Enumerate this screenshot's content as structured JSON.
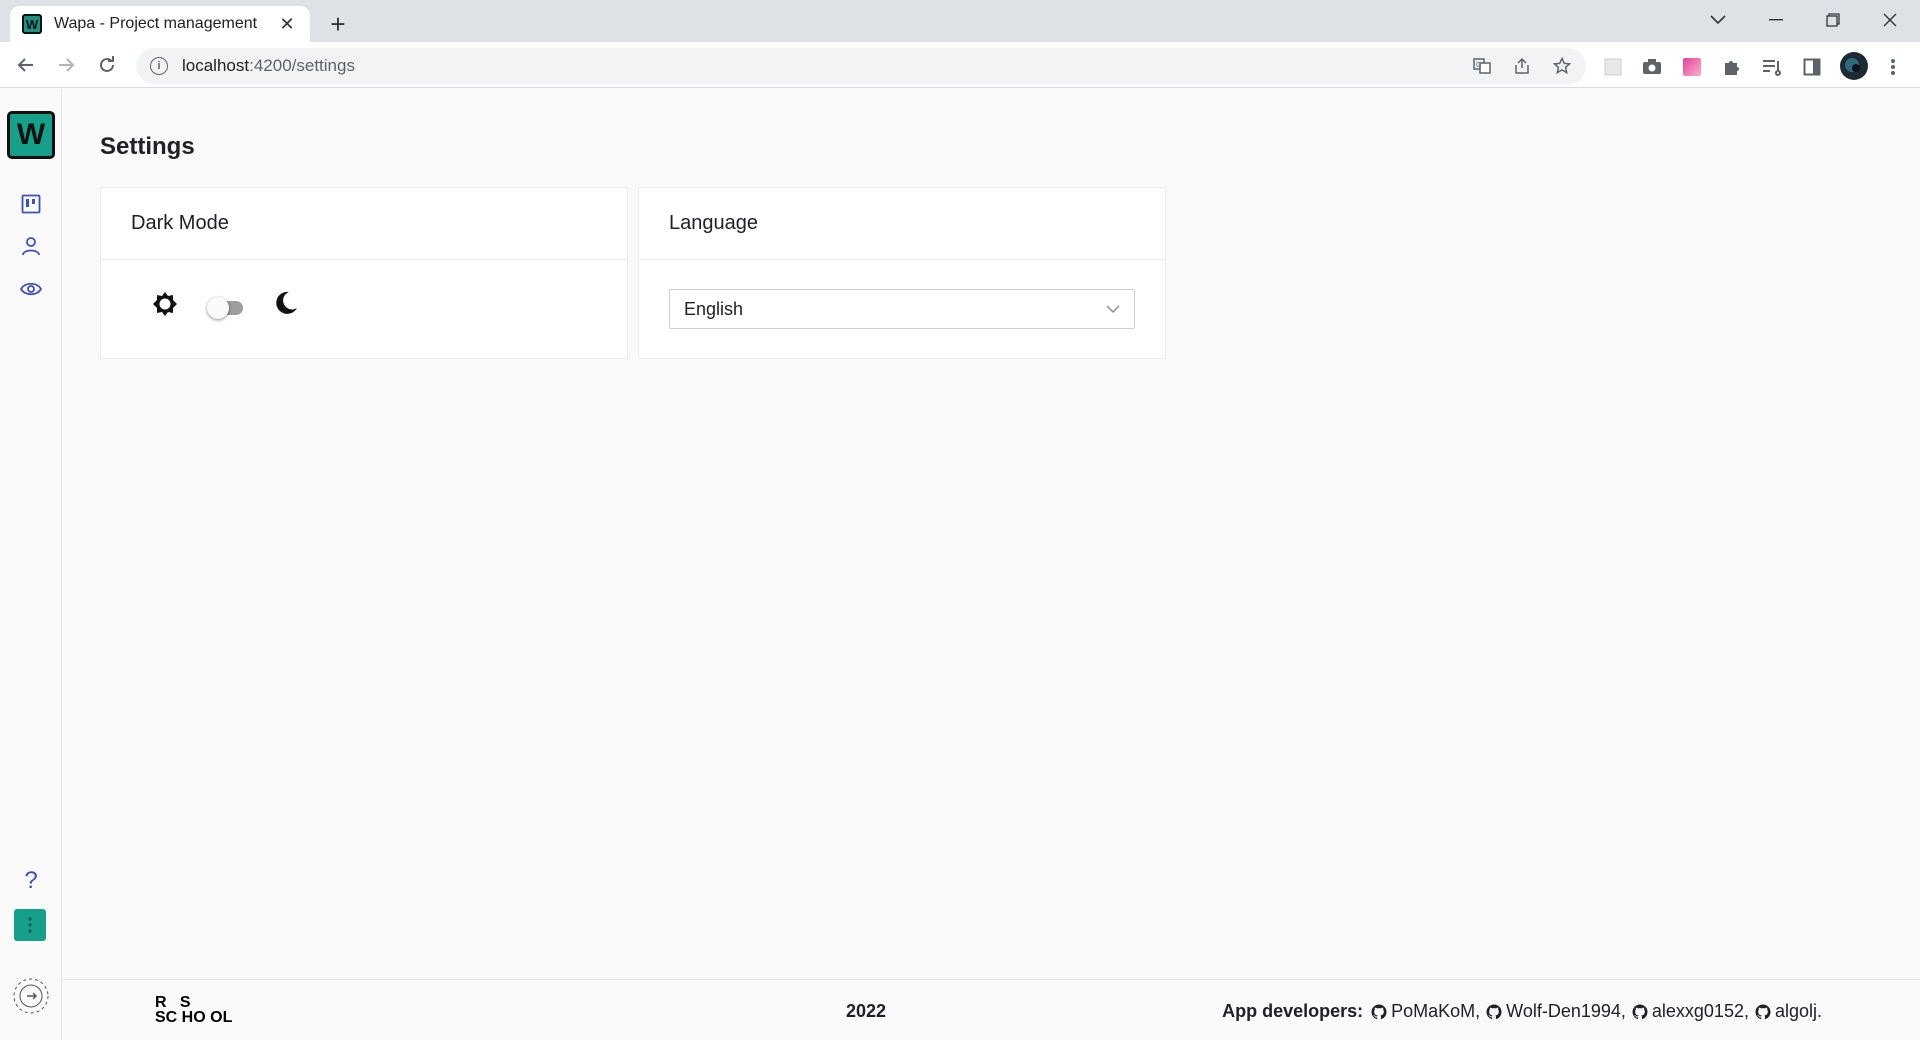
{
  "browser": {
    "tab_title": "Wapa - Project management",
    "tab_favicon_letter": "W",
    "url_host": "localhost",
    "url_path": ":4200/settings",
    "icons": [
      "back-icon",
      "forward-icon",
      "reload-icon",
      "site-info-icon",
      "translate-icon",
      "share-icon",
      "bookmark-star-icon",
      "extension-icon",
      "camera-icon",
      "color-extension-icon",
      "puzzle-icon",
      "reading-list-icon",
      "side-panel-icon",
      "profile-avatar",
      "more-menu-icon"
    ]
  },
  "app": {
    "logo_letter": "W",
    "brand_color": "#16a08a",
    "accent_color": "#3f51b5",
    "sidebar": {
      "items": [
        {
          "icon": "board-icon"
        },
        {
          "icon": "user-icon"
        },
        {
          "icon": "eye-icon"
        }
      ],
      "help_label": "?"
    },
    "page_title": "Settings",
    "dark_mode": {
      "title": "Dark Mode",
      "enabled": false
    },
    "language": {
      "title": "Language",
      "selected": "English"
    },
    "footer": {
      "year": "2022",
      "logo_top": "R   S",
      "logo_bottom": "SC HO OL",
      "devs_label": "App developers:",
      "devs": [
        "PoMaKoM,",
        "Wolf-Den1994,",
        "alexxg0152,",
        "algolj."
      ]
    }
  }
}
